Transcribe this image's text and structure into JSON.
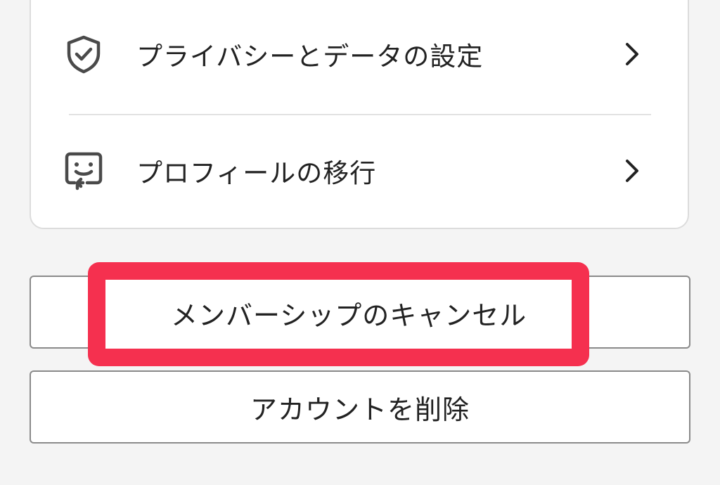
{
  "settings_menu": {
    "items": [
      {
        "icon": "shield-check-icon",
        "label": "プライバシーとデータの設定",
        "chevron": "chevron-right-icon"
      },
      {
        "icon": "profile-transfer-icon",
        "label": "プロフィールの移行",
        "chevron": "chevron-right-icon"
      }
    ]
  },
  "buttons": {
    "cancel_membership_label": "メンバーシップのキャンセル",
    "delete_account_label": "アカウントを削除"
  },
  "annotation": {
    "highlight_color": "#f5304f"
  },
  "colors": {
    "background": "#f4f4f4",
    "card": "#ffffff",
    "text": "#222222",
    "icon": "#4a4a4a"
  }
}
